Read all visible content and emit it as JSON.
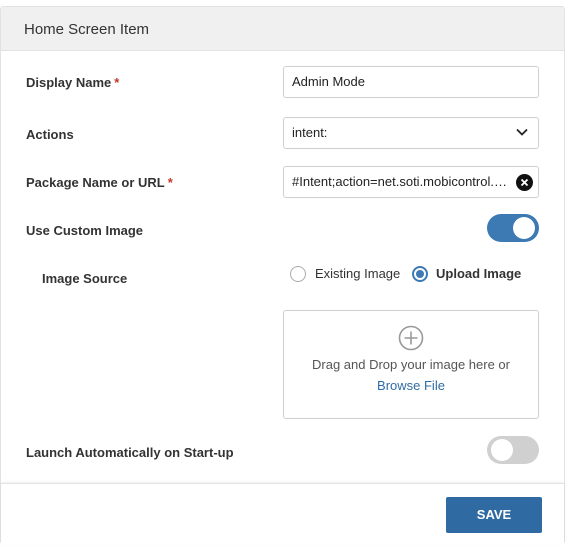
{
  "dialog": {
    "title": "Home Screen Item"
  },
  "form": {
    "display_name": {
      "label": "Display Name",
      "required_mark": "*",
      "value": "Admin Mode"
    },
    "actions": {
      "label": "Actions",
      "value": "intent:"
    },
    "package": {
      "label": "Package Name or URL",
      "required_mark": "*",
      "value": "#Intent;action=net.soti.mobicontrol.admin;end"
    },
    "use_custom_image": {
      "label": "Use Custom Image",
      "on": true
    },
    "image_source": {
      "label": "Image Source",
      "options": [
        "Existing Image",
        "Upload Image"
      ],
      "selected": "Upload Image"
    },
    "dropzone": {
      "text": "Drag and Drop your image here or",
      "link": "Browse File"
    },
    "launch_auto": {
      "label": "Launch Automatically on Start-up",
      "on": false
    }
  },
  "footer": {
    "save_label": "SAVE"
  },
  "colors": {
    "accent": "#3d7ab3",
    "button": "#2f6aa3",
    "required": "#c0392b",
    "link": "#2e6da4"
  },
  "icons": {
    "select_arrow": "chevron-down-icon",
    "clear": "clear-icon",
    "upload": "add-circle-icon"
  }
}
